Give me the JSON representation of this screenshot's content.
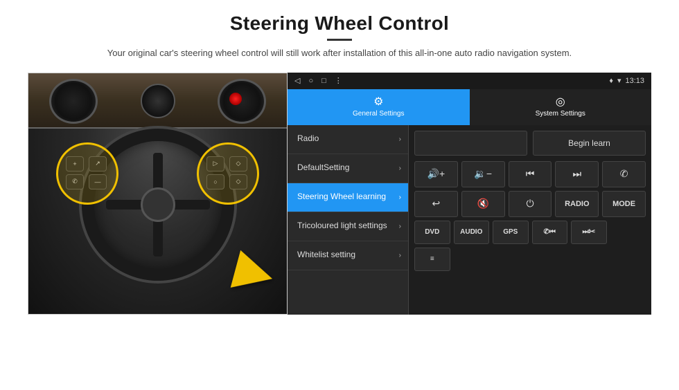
{
  "header": {
    "title": "Steering Wheel Control",
    "subtitle": "Your original car's steering wheel control will still work after installation of this all-in-one auto radio navigation system."
  },
  "android": {
    "statusBar": {
      "time": "13:13",
      "wifiIcon": "▾",
      "locationIcon": "♦"
    },
    "tabs": [
      {
        "id": "general",
        "icon": "⚙",
        "label": "General Settings",
        "active": true
      },
      {
        "id": "system",
        "icon": "◎",
        "label": "System Settings",
        "active": false
      }
    ],
    "menuItems": [
      {
        "id": "radio",
        "label": "Radio",
        "active": false
      },
      {
        "id": "default",
        "label": "DefaultSetting",
        "active": false
      },
      {
        "id": "steering",
        "label": "Steering Wheel learning",
        "active": true
      },
      {
        "id": "tricolour",
        "label": "Tricoloured light settings",
        "active": false
      },
      {
        "id": "whitelist",
        "label": "Whitelist setting",
        "active": false
      }
    ],
    "beginLearnLabel": "Begin learn",
    "controls": {
      "row1": [
        {
          "icon": "◀+",
          "label": "vol-up"
        },
        {
          "icon": "◀−",
          "label": "vol-down"
        },
        {
          "icon": "⏮",
          "label": "prev-track"
        },
        {
          "icon": "⏭",
          "label": "next-track"
        },
        {
          "icon": "✆",
          "label": "phone"
        }
      ],
      "row2": [
        {
          "icon": "↩",
          "label": "answer"
        },
        {
          "icon": "🔇",
          "label": "mute"
        },
        {
          "icon": "⏻",
          "label": "power"
        },
        {
          "text": "RADIO",
          "label": "radio-btn"
        },
        {
          "text": "MODE",
          "label": "mode-btn"
        }
      ],
      "row3": [
        {
          "text": "DVD",
          "label": "dvd-btn"
        },
        {
          "text": "AUDIO",
          "label": "audio-btn"
        },
        {
          "text": "GPS",
          "label": "gps-btn"
        },
        {
          "icon": "✆⏮",
          "label": "phone-prev"
        },
        {
          "icon": "✂⏭",
          "label": "phone-next"
        }
      ],
      "row4": [
        {
          "icon": "≡",
          "label": "menu-icon"
        }
      ]
    }
  }
}
